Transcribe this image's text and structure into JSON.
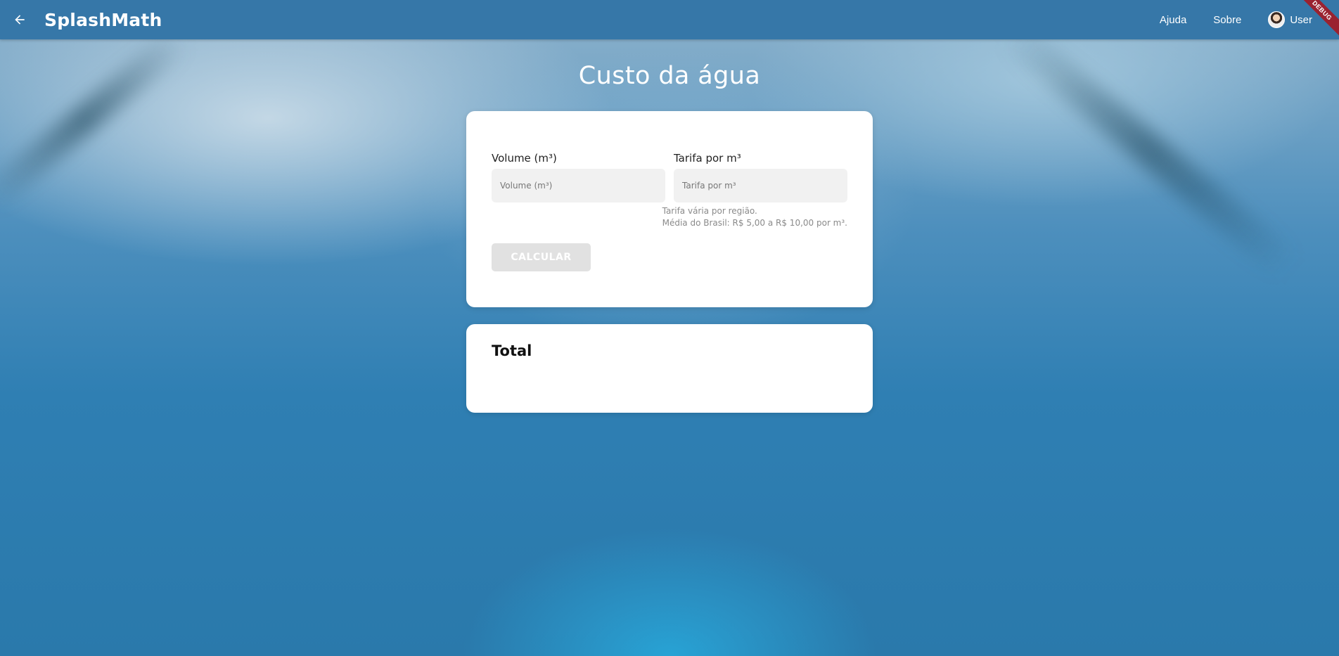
{
  "appbar": {
    "brand": "SplashMath",
    "nav": [
      {
        "label": "Ajuda"
      },
      {
        "label": "Sobre"
      }
    ],
    "user_label": "User",
    "debug_label": "DEBUG",
    "back_icon": "arrow-left-icon"
  },
  "page": {
    "title": "Custo da água"
  },
  "form": {
    "volume": {
      "label": "Volume (m³)",
      "placeholder": "Volume (m³)",
      "value": ""
    },
    "tarifa": {
      "label": "Tarifa por m³",
      "placeholder": "Tarifa por m³",
      "value": ""
    },
    "helper_line1": "Tarifa vária por região.",
    "helper_line2": "Média do Brasil: R$ 5,00 a R$ 10,00 por m³.",
    "calculate_label": "CALCULAR"
  },
  "result": {
    "title": "Total"
  },
  "colors": {
    "appbar": "#3677a8",
    "button_disabled": "#e1e1e1",
    "debug_ribbon": "#9a2230"
  }
}
